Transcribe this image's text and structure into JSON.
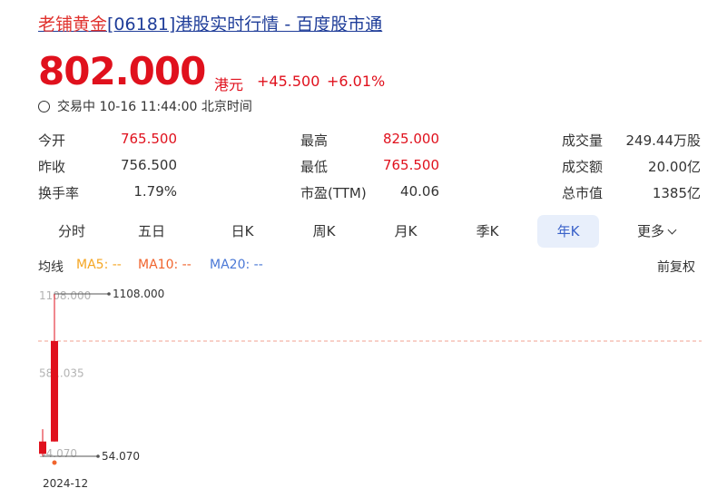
{
  "header": {
    "name": "老铺黄金",
    "rest": "[06181]港股实时行情 - 百度股市通",
    "price": "802.000",
    "currency": "港元",
    "change": "+45.500",
    "change_pct": "+6.01%",
    "status": "交易中 10-16 11:44:00 北京时间"
  },
  "stats": [
    {
      "label": "今开",
      "value": "765.500"
    },
    {
      "label": "昨收",
      "value": "756.500"
    },
    {
      "label": "换手率",
      "value": "1.79%"
    },
    {
      "label": "最高",
      "value": "825.000"
    },
    {
      "label": "最低",
      "value": "765.500"
    },
    {
      "label": "市盈(TTM)",
      "value": "40.06"
    },
    {
      "label": "成交量",
      "value": "249.44万股"
    },
    {
      "label": "成交额",
      "value": "20.00亿"
    },
    {
      "label": "总市值",
      "value": "1385亿"
    }
  ],
  "tabs": [
    "分时",
    "五日",
    "日K",
    "周K",
    "月K",
    "季K",
    "年K",
    "更多"
  ],
  "active_tab": "年K",
  "ma_bar": {
    "label": "均线",
    "ma5": "MA5: --",
    "ma10": "MA10: --",
    "ma20": "MA20: --",
    "adjust": "前复权"
  },
  "colors": {
    "up": "#e0111d",
    "ma5": "#f5a623",
    "ma10": "#f0642d",
    "ma20": "#4a78d6",
    "active_tab": "#3a62c9"
  },
  "chart_data": {
    "type": "candlestick",
    "y_tick_labels": [
      "1108.000",
      "581.035",
      "54.070"
    ],
    "x_labels": [
      "2024-12"
    ],
    "max_label": "1108.000",
    "min_label": "54.070",
    "current_price": 802.0,
    "candles": [
      {
        "open": 70,
        "close": 150,
        "high": 230,
        "low": 54.07
      },
      {
        "open": 150,
        "close": 802,
        "high": 1108,
        "low": 150
      }
    ]
  }
}
